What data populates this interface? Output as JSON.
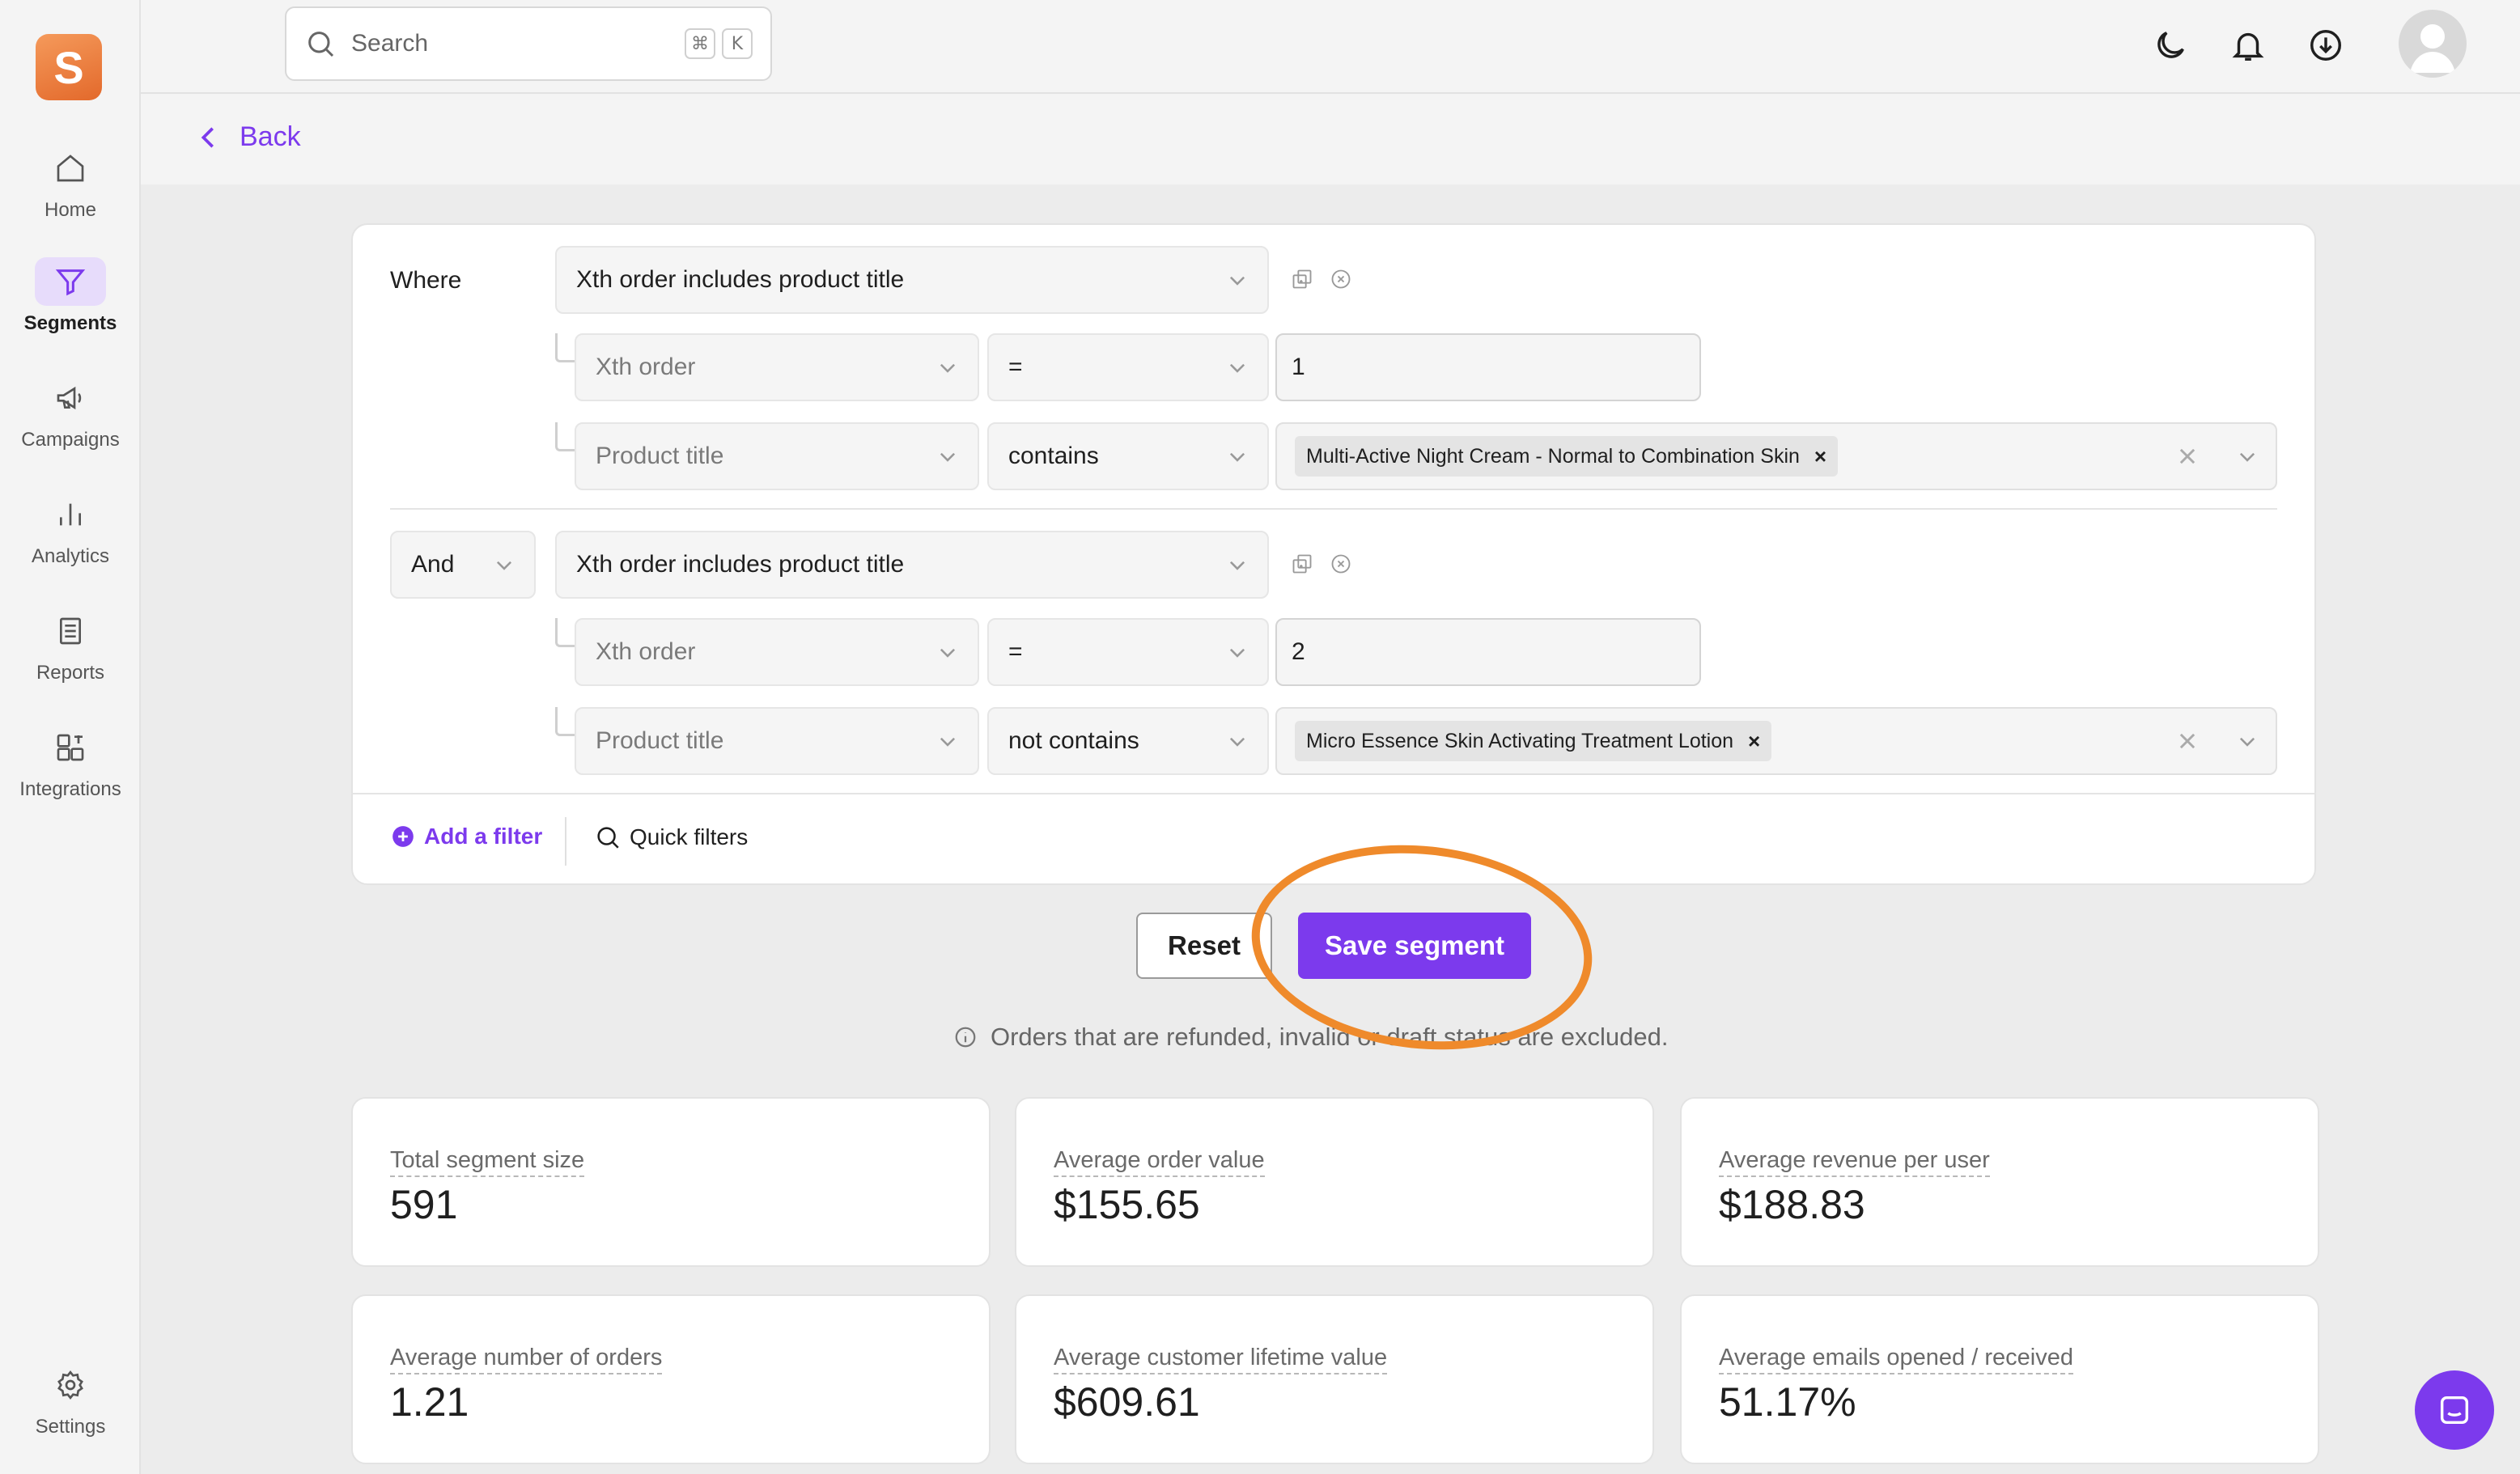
{
  "sidebar": {
    "logo_letter": "S",
    "items": [
      {
        "label": "Home",
        "icon": "home-icon"
      },
      {
        "label": "Segments",
        "icon": "filter-icon",
        "active": true
      },
      {
        "label": "Campaigns",
        "icon": "megaphone-icon"
      },
      {
        "label": "Analytics",
        "icon": "bar-chart-icon"
      },
      {
        "label": "Reports",
        "icon": "document-icon"
      },
      {
        "label": "Integrations",
        "icon": "integrations-icon"
      }
    ],
    "settings_label": "Settings"
  },
  "header": {
    "search_placeholder": "Search",
    "shortcut_cmd": "⌘",
    "shortcut_key": "K"
  },
  "back_label": "Back",
  "filters": {
    "group1": {
      "prefix": "Where",
      "condition": "Xth order includes product title",
      "row1": {
        "field": "Xth order",
        "operator": "=",
        "value": "1"
      },
      "row2": {
        "field": "Product title",
        "operator": "contains",
        "tag": "Multi-Active Night Cream - Normal to Combination Skin"
      }
    },
    "group2": {
      "prefix": "And",
      "condition": "Xth order includes product title",
      "row1": {
        "field": "Xth order",
        "operator": "=",
        "value": "2"
      },
      "row2": {
        "field": "Product title",
        "operator": "not contains",
        "tag": "Micro Essence Skin Activating Treatment Lotion"
      }
    },
    "add_filter_label": "Add a filter",
    "quick_filters_label": "Quick filters"
  },
  "actions": {
    "reset_label": "Reset",
    "save_label": "Save segment"
  },
  "note": "Orders that are refunded, invalid or draft status are excluded.",
  "stats": [
    {
      "label": "Total segment size",
      "value": "591"
    },
    {
      "label": "Average order value",
      "value": "$155.65"
    },
    {
      "label": "Average revenue per user",
      "value": "$188.83"
    },
    {
      "label": "Average number of orders",
      "value": "1.21"
    },
    {
      "label": "Average customer lifetime value",
      "value": "$609.61"
    },
    {
      "label": "Average emails opened / received",
      "value": "51.17%"
    }
  ],
  "colors": {
    "accent": "#7c3aed",
    "highlight_ring": "#ef8a2b",
    "logo": "#e8763a"
  }
}
